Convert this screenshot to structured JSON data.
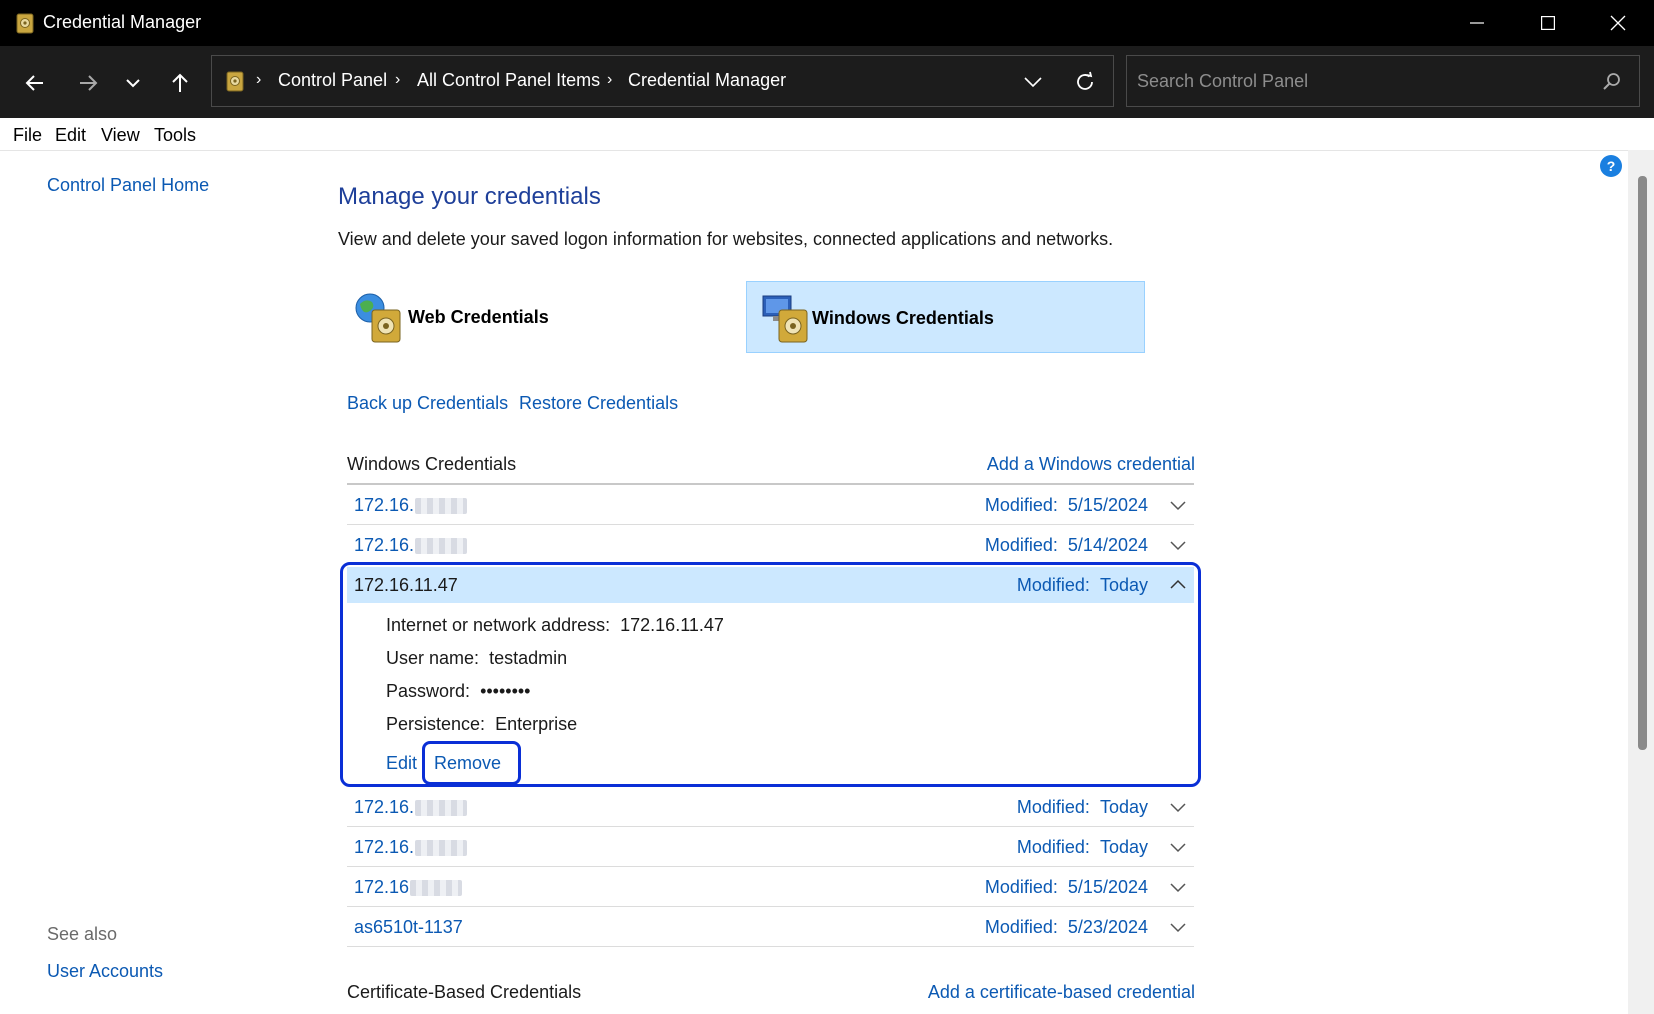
{
  "window": {
    "title": "Credential Manager"
  },
  "nav": {
    "breadcrumbs": [
      "Control Panel",
      "All Control Panel Items",
      "Credential Manager"
    ],
    "search_placeholder": "Search Control Panel"
  },
  "menu": [
    "File",
    "Edit",
    "View",
    "Tools"
  ],
  "sidebar": {
    "home_link": "Control Panel Home",
    "see_also_label": "See also",
    "see_also_links": [
      "User Accounts"
    ]
  },
  "main": {
    "title": "Manage your credentials",
    "description": "View and delete your saved logon information for websites, connected applications and networks.",
    "tiles": [
      {
        "label": "Web Credentials",
        "selected": false
      },
      {
        "label": "Windows Credentials",
        "selected": true
      }
    ],
    "actions": {
      "backup": "Back up Credentials",
      "restore": "Restore Credentials"
    },
    "windows_section": {
      "title": "Windows Credentials",
      "add_link": "Add a Windows credential",
      "rows_before": [
        {
          "name": "172.16.",
          "modified_label": "Modified:",
          "modified": "5/15/2024"
        },
        {
          "name": "172.16.",
          "modified_label": "Modified:",
          "modified": "5/14/2024"
        }
      ],
      "expanded": {
        "name": "172.16.11.47",
        "modified_label": "Modified:",
        "modified": "Today",
        "address_label": "Internet or network address:",
        "address": "172.16.11.47",
        "user_label": "User name:",
        "user": "testadmin",
        "password_label": "Password:",
        "password": "••••••••",
        "persistence_label": "Persistence:",
        "persistence": "Enterprise",
        "edit": "Edit",
        "remove": "Remove"
      },
      "rows_after": [
        {
          "name": "172.16.",
          "modified_label": "Modified:",
          "modified": "Today"
        },
        {
          "name": "172.16.",
          "modified_label": "Modified:",
          "modified": "Today"
        },
        {
          "name": "172.16",
          "modified_label": "Modified:",
          "modified": "5/15/2024"
        },
        {
          "name": "as6510t-1137",
          "modified_label": "Modified:",
          "modified": "5/23/2024"
        }
      ]
    },
    "cert_section": {
      "title": "Certificate-Based Credentials",
      "add_link": "Add a certificate-based credential"
    }
  },
  "colors": {
    "link": "#0b59b3",
    "heading": "#1e3f99",
    "highlight": "#cce8ff",
    "focus": "#0a2fd6"
  }
}
